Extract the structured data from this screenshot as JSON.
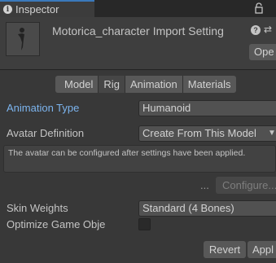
{
  "window": {
    "tab_title": "Inspector",
    "tab_icon": "info-icon",
    "lock_icon": "lock-icon"
  },
  "header": {
    "title": "Motorica_character Import Setting",
    "help_icon": "help-icon",
    "preset_icon": "preset-icon",
    "open_label": "Ope"
  },
  "tabs": [
    {
      "label": "Model",
      "active": false
    },
    {
      "label": "Rig",
      "active": true
    },
    {
      "label": "Animation",
      "active": false
    },
    {
      "label": "Materials",
      "active": false
    }
  ],
  "rig": {
    "animation_type_label": "Animation Type",
    "animation_type_value": "Humanoid",
    "avatar_definition_label": "Avatar Definition",
    "avatar_definition_value": "Create From This Model",
    "note_text": "The avatar can be configured after settings have been applied.",
    "ellipsis": "...",
    "configure_label": "Configure...",
    "skin_weights_label": "Skin Weights",
    "skin_weights_value": "Standard (4 Bones)",
    "optimize_label": "Optimize Game Obje",
    "optimize_checked": false
  },
  "footer": {
    "revert_label": "Revert",
    "apply_label": "Appl"
  },
  "colors": {
    "accent_label": "#7cb4ee",
    "active_tab_line": "#3a79bb",
    "panel_bg": "#383838"
  }
}
